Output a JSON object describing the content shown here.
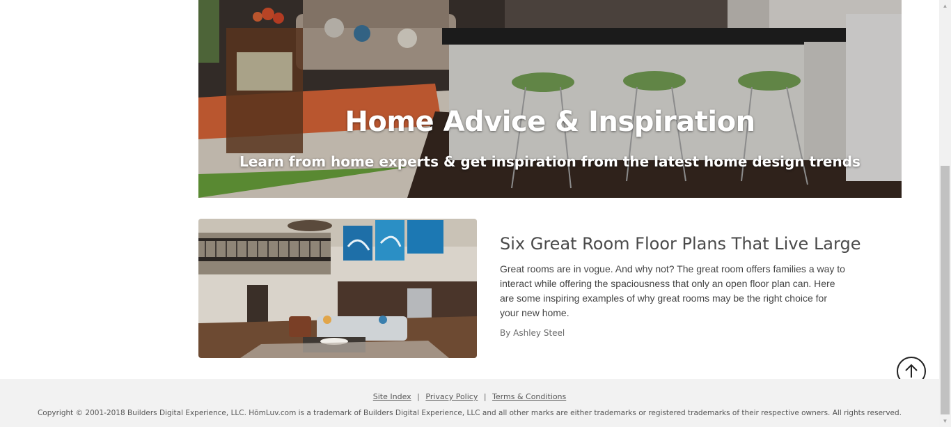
{
  "hero": {
    "title": "Home Advice & Inspiration",
    "subtitle": "Learn from home experts & get inspiration from the latest home design trends"
  },
  "article": {
    "title": "Six Great Room Floor Plans That Live Large",
    "excerpt": "Great rooms are in vogue. And why not? The great room offers families a way to interact while offering the spaciousness that only an open floor plan can. Here are some inspiring examples of why great rooms may be the right choice for your new home.",
    "author": "By Ashley Steel"
  },
  "footer": {
    "links": [
      "Site Index",
      "Privacy Policy",
      "Terms & Conditions"
    ],
    "separator": "|",
    "copyright": "Copyright © 2001-2018 Builders Digital Experience, LLC. HōmLuv.com is a trademark of Builders Digital Experience, LLC and all other marks are either trademarks or registered trademarks of their respective owners. All rights reserved."
  },
  "icons": {
    "back_to_top": "arrow-up-circle-icon",
    "scroll_up": "triangle-up-icon",
    "scroll_down": "triangle-down-icon"
  },
  "colors": {
    "footer_bg": "#f2f2f2",
    "title_text": "#4a4a4a",
    "body_text": "#444444"
  }
}
